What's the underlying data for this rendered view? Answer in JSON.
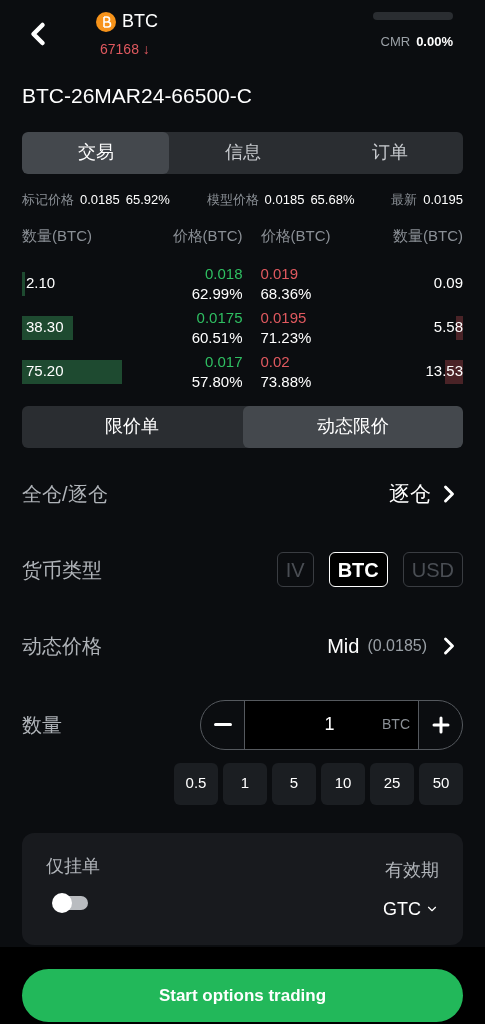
{
  "header": {
    "coin": "BTC",
    "price": "67168 ↓",
    "cmr": {
      "label": "CMR",
      "value": "0.00%"
    }
  },
  "instrument": "BTC-26MAR24-66500-C",
  "tabs": [
    {
      "label": "交易",
      "selected": true
    },
    {
      "label": "信息",
      "selected": false
    },
    {
      "label": "订单",
      "selected": false
    }
  ],
  "info": [
    {
      "label": "标记价格",
      "values": [
        "0.0185",
        "65.92%"
      ]
    },
    {
      "label": "模型价格",
      "values": [
        "0.0185",
        "65.68%"
      ]
    },
    {
      "label": "最新",
      "values": [
        "0.0195"
      ]
    }
  ],
  "book": {
    "columns": [
      "数量(BTC)",
      "价格(BTC)",
      "价格(BTC)",
      "数量(BTC)"
    ],
    "rows": [
      {
        "bid": {
          "qty": "2.10",
          "price": "0.018",
          "iv": "62.99%"
        },
        "ask": {
          "price": "0.019",
          "iv": "68.36%",
          "qty": "0.09"
        }
      },
      {
        "bid": {
          "qty": "38.30",
          "price": "0.0175",
          "iv": "60.51%"
        },
        "ask": {
          "price": "0.0195",
          "iv": "71.23%",
          "qty": "5.58"
        }
      },
      {
        "bid": {
          "qty": "75.20",
          "price": "0.017",
          "iv": "57.80%"
        },
        "ask": {
          "price": "0.02",
          "iv": "73.88%",
          "qty": "13.53"
        }
      }
    ]
  },
  "order_types": [
    {
      "label": "限价单",
      "selected": false
    },
    {
      "label": "动态限价",
      "selected": true
    }
  ],
  "margin": {
    "label": "全仓/逐仓",
    "value": "逐仓"
  },
  "currency": {
    "label": "货币类型",
    "options": [
      {
        "label": "IV",
        "selected": false
      },
      {
        "label": "BTC",
        "selected": true
      },
      {
        "label": "USD",
        "selected": false
      }
    ]
  },
  "dynamic_price": {
    "label": "动态价格",
    "value": "Mid",
    "detail": "(0.0185)"
  },
  "quantity": {
    "label": "数量",
    "value": "1",
    "unit": "BTC",
    "presets": [
      "0.5",
      "1",
      "5",
      "10",
      "25",
      "50"
    ]
  },
  "options": {
    "post_only_label": "仅挂单",
    "post_only_on": false,
    "validity_label": "有效期",
    "validity_value": "GTC"
  },
  "submit": "Start options trading"
}
